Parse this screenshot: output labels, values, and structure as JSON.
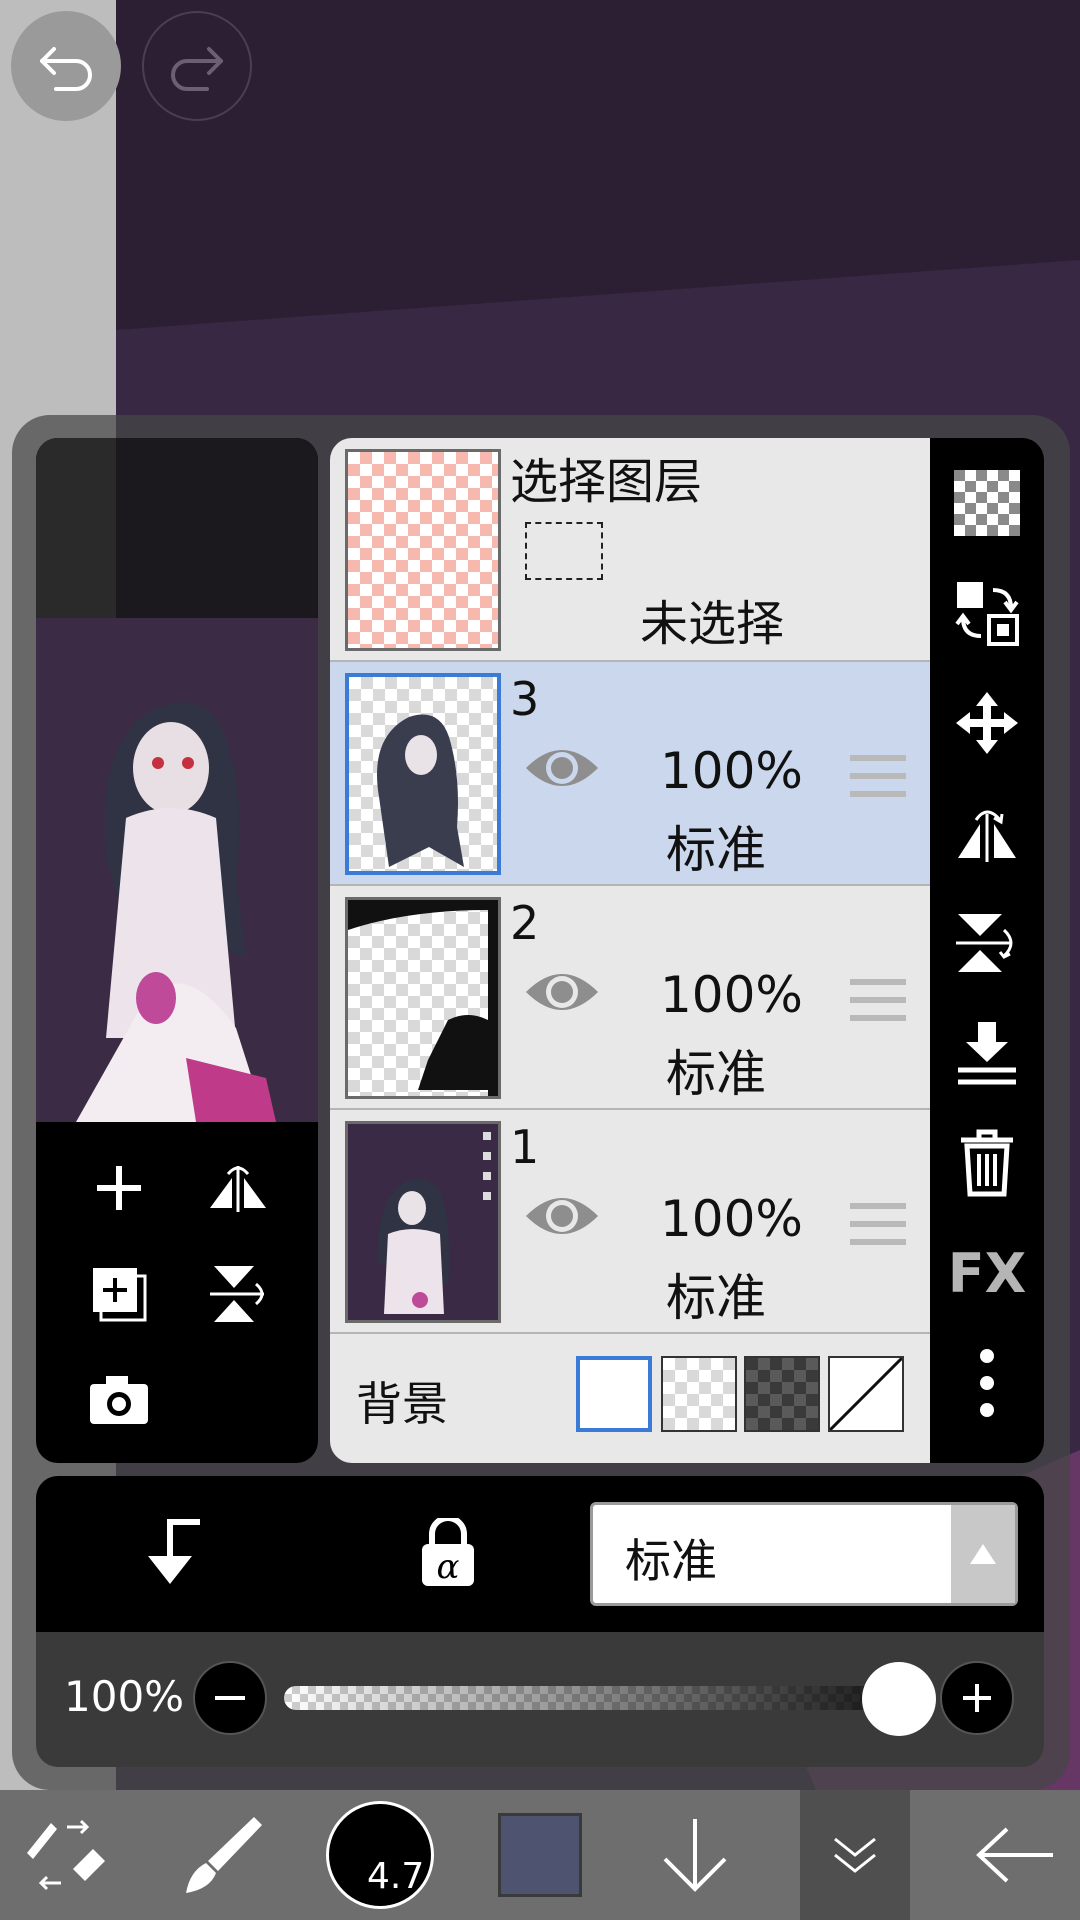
{
  "canvas": {
    "undo_icon": "undo-icon",
    "redo_icon": "redo-icon"
  },
  "select_layer": {
    "title": "选择图层",
    "status": "未选择"
  },
  "layers": [
    {
      "number": "3",
      "opacity": "100%",
      "blend": "标准",
      "selected": true
    },
    {
      "number": "2",
      "opacity": "100%",
      "blend": "标准",
      "selected": false
    },
    {
      "number": "1",
      "opacity": "100%",
      "blend": "标准",
      "selected": false
    }
  ],
  "background": {
    "label": "背景",
    "options": [
      "white",
      "transparent",
      "dark-checker",
      "none"
    ],
    "selected": "white"
  },
  "blend_mode": {
    "value": "标准"
  },
  "opacity": {
    "label": "100%",
    "value": 1.0
  },
  "toolbar": {
    "brush_size": "4.7",
    "color": "#4e5470"
  },
  "right_tools": [
    "transparency-icon",
    "swap-icon",
    "move-icon",
    "flip-horizontal-icon",
    "flip-vertical-icon",
    "merge-down-icon",
    "trash-icon",
    "fx-icon",
    "more-icon"
  ],
  "fx_label": "FX",
  "colors": {
    "selected_row": "#cad7ec",
    "selected_border": "#3a7bd5",
    "panel_bg": "#e8e8e8"
  }
}
